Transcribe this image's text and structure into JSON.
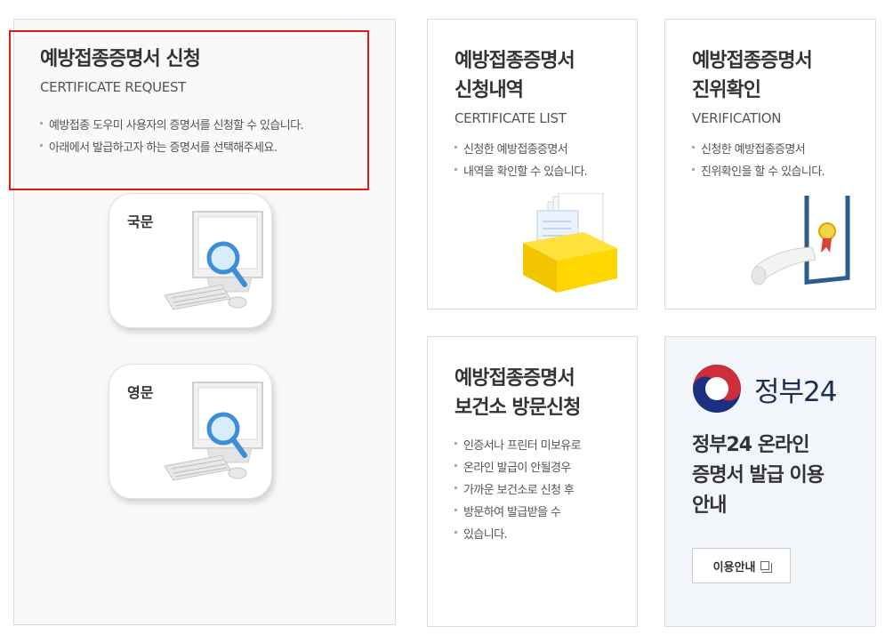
{
  "request": {
    "title": "예방접종증명서 신청",
    "subtitle": "CERTIFICATE REQUEST",
    "desc": [
      "예방접종 도우미 사용자의 증명서를 신청할 수 있습니다.",
      "아래에서 발급하고자 하는 증명서를 선택해주세요."
    ],
    "buttons": [
      {
        "label": "국문"
      },
      {
        "label": "영문"
      }
    ]
  },
  "list": {
    "title_line1": "예방접종증명서",
    "title_line2": "신청내역",
    "subtitle": "CERTIFICATE LIST",
    "desc_line1": "신청한 예방접종증명서",
    "desc_line2": "내역을 확인할 수 있습니다."
  },
  "verify": {
    "title_line1": "예방접종증명서",
    "title_line2": "진위확인",
    "subtitle": "VERIFICATION",
    "desc_line1": "신청한 예방접종증명서",
    "desc_line2": "진위확인을 할 수 있습니다."
  },
  "visit": {
    "title_line1": "예방접종증명서",
    "title_line2": "보건소 방문신청",
    "desc_lines": [
      "인증서나 프린터 미보유로",
      "온라인 발급이 안될경우",
      "가까운 보건소로 신청 후",
      "방문하여 발급받을 수",
      "있습니다."
    ]
  },
  "gov24": {
    "logo_text": "정부24",
    "title_line1": "정부24 온라인",
    "title_line2": "증명서 발급 이용",
    "title_line3": "안내",
    "guide_button": "이용안내"
  },
  "colors": {
    "highlight": "#e01b1b",
    "gov_blue": "#1d2f4f",
    "gov_red": "#cd2e3a"
  }
}
